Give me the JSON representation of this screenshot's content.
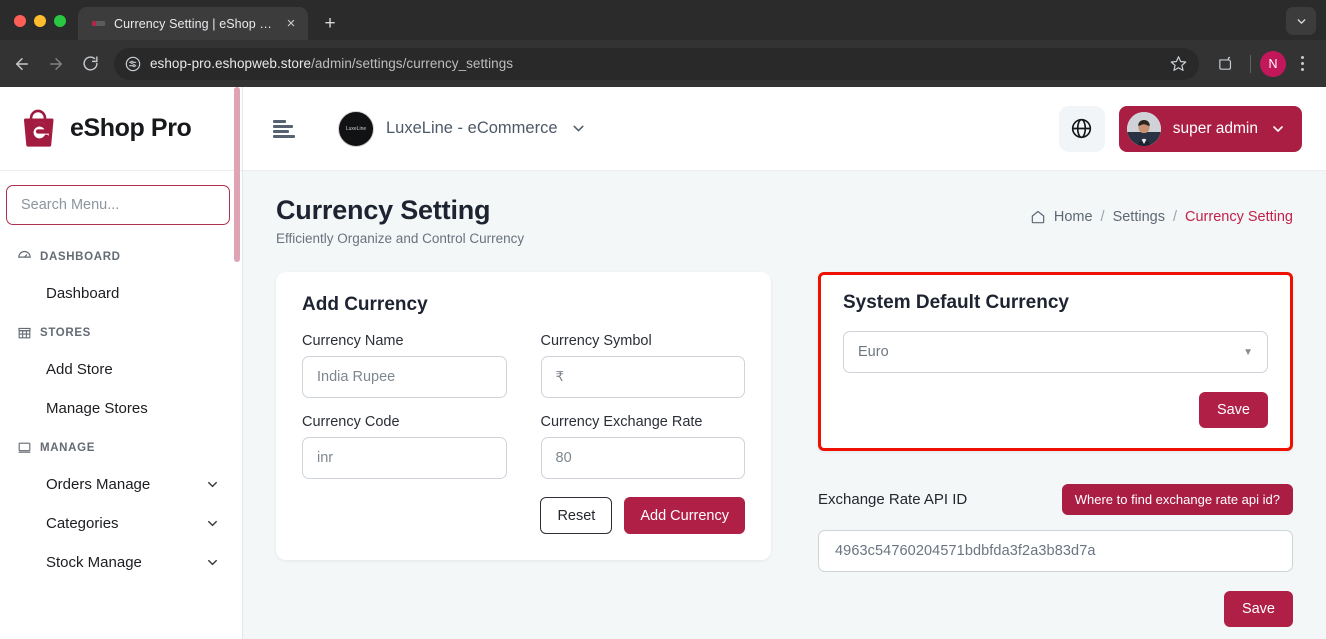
{
  "browser": {
    "tab": {
      "title": "Currency Setting | eShop Pro",
      "favicon": "site-favicon",
      "close": "×"
    },
    "new_tab": "+",
    "tab_list_chevron": "chevron-down-icon",
    "url_prefix": "eshop-pro.eshopweb.store",
    "url_path": "/admin/settings/currency_settings",
    "profile_initial": "N",
    "accent": "#c2185b"
  },
  "sidebar": {
    "brand": "eShop Pro",
    "search_placeholder": "Search Menu...",
    "groups": [
      {
        "label": "DASHBOARD",
        "icon": "gauge-icon",
        "items": [
          {
            "label": "Dashboard",
            "expandable": false
          }
        ]
      },
      {
        "label": "STORES",
        "icon": "store-icon",
        "items": [
          {
            "label": "Add Store",
            "expandable": false
          },
          {
            "label": "Manage Stores",
            "expandable": false
          }
        ]
      },
      {
        "label": "MANAGE",
        "icon": "monitor-icon",
        "items": [
          {
            "label": "Orders Manage",
            "expandable": true
          },
          {
            "label": "Categories",
            "expandable": true
          },
          {
            "label": "Stock Manage",
            "expandable": true
          }
        ]
      }
    ]
  },
  "topbar": {
    "menu_toggle": "hamburger-icon",
    "store_name": "LuxeLine - eCommerce",
    "store_caret": "chevron-down-icon",
    "language_icon": "globe-icon",
    "admin_name": "super admin",
    "admin_caret": "chevron-down-icon",
    "admin_btn_color": "#ab1e43"
  },
  "page": {
    "title": "Currency Setting",
    "subtitle": "Efficiently Organize and Control Currency",
    "breadcrumb": {
      "home_icon": "home-icon",
      "home": "Home",
      "sep": "/",
      "middle": "Settings",
      "current": "Currency Setting",
      "current_color": "#c32149"
    }
  },
  "add_currency": {
    "title": "Add Currency",
    "fields": [
      {
        "label": "Currency Name",
        "placeholder": "India Rupee",
        "value": ""
      },
      {
        "label": "Currency Symbol",
        "placeholder": "₹",
        "value": ""
      },
      {
        "label": "Currency Code",
        "placeholder": "inr",
        "value": ""
      },
      {
        "label": "Currency Exchange Rate",
        "placeholder": "80",
        "value": ""
      }
    ],
    "reset_label": "Reset",
    "submit_label": "Add Currency"
  },
  "default_currency": {
    "title": "System Default Currency",
    "selected": "Euro",
    "caret": "▼",
    "save_label": "Save",
    "highlight_color": "#ee1100"
  },
  "exchange_api": {
    "label": "Exchange Rate API ID",
    "help_label": "Where to find exchange rate api id?",
    "value": "4963c54760204571bdbfda3f2a3b83d7a",
    "save_label": "Save"
  }
}
